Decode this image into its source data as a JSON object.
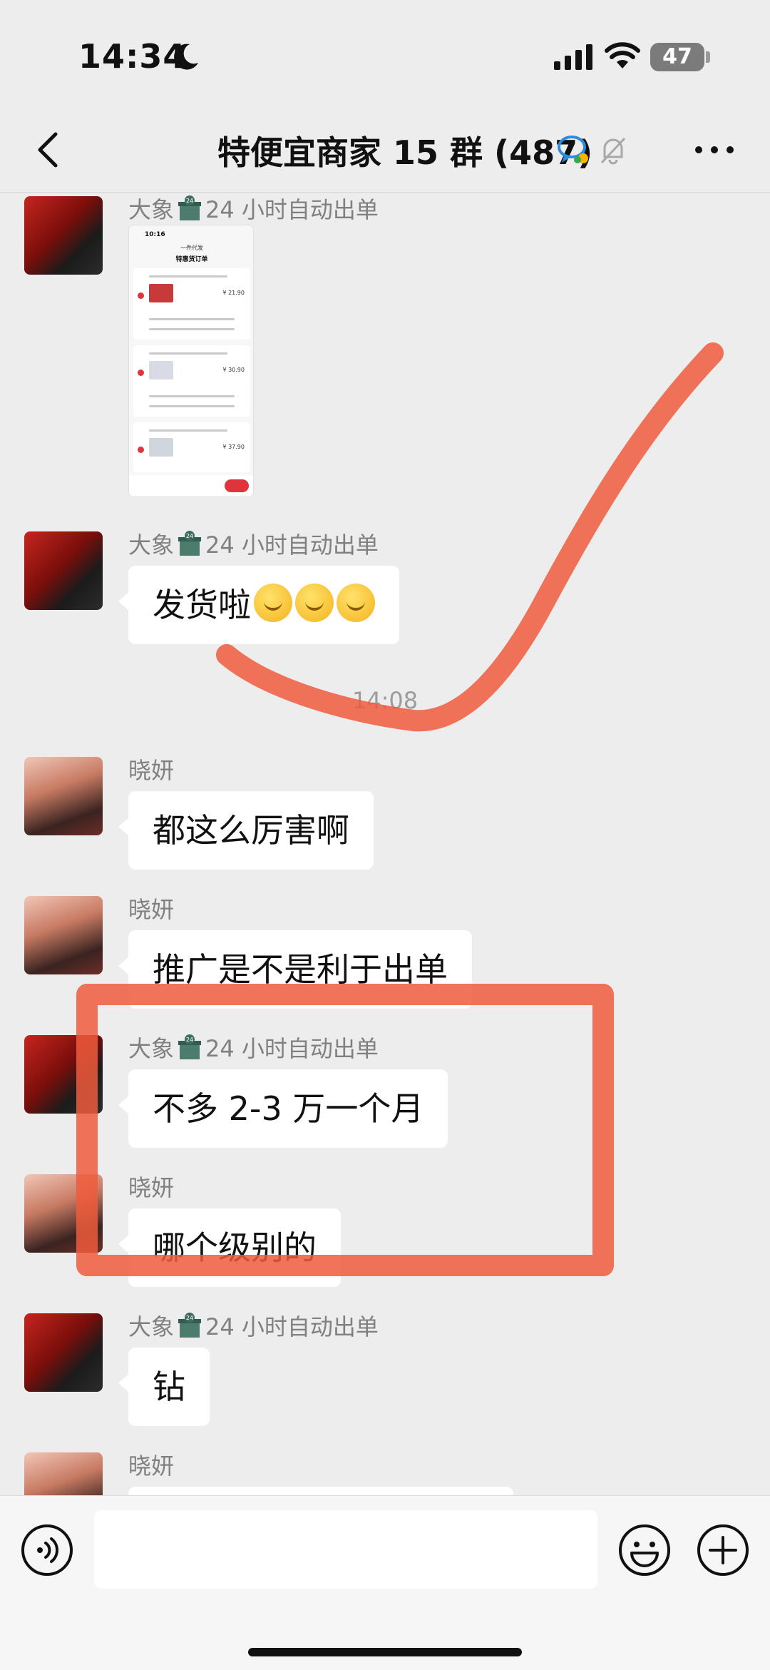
{
  "status_bar": {
    "time": "14:34",
    "battery": "47"
  },
  "header": {
    "title": "特便宜商家 15 群 (487)"
  },
  "sender_names": {
    "elephant_prefix": "大象",
    "elephant_suffix": "24 小时自动出单",
    "xiaoyan": "晓妍"
  },
  "messages": [
    {
      "sender": "大象 24 小时自动出单",
      "type": "image"
    },
    {
      "sender": "大象 24 小时自动出单",
      "text": "发货啦"
    },
    {
      "sender": "晓妍",
      "text": "都这么厉害啊"
    },
    {
      "sender": "晓妍",
      "text": "推广是不是利于出单"
    },
    {
      "sender": "大象 24 小时自动出单",
      "text": "不多 2-3 万一个月"
    },
    {
      "sender": "晓妍",
      "text": "哪个级别的"
    },
    {
      "sender": "大象 24 小时自动出单",
      "text": "钻"
    },
    {
      "sender": "晓妍",
      "text": ""
    }
  ],
  "timestamp": "14:08",
  "thumbnail": {
    "time": "10:16",
    "app": "一件代发",
    "title": "特惠货订单",
    "prices": [
      "¥ 21.90",
      "¥ 30.90",
      "¥ 37.90"
    ]
  },
  "input": {
    "value": "",
    "placeholder": ""
  },
  "colors": {
    "background": "#ededed",
    "bubble": "#ffffff",
    "annotation": "#ee5a3c"
  },
  "icons": {
    "back": "chevron-left-icon",
    "chat_badge": "chat-bubble-icon",
    "mute": "bell-mute-icon",
    "more": "ellipsis-icon",
    "voice": "voice-icon",
    "emoji": "smiley-icon",
    "plus": "plus-icon"
  }
}
